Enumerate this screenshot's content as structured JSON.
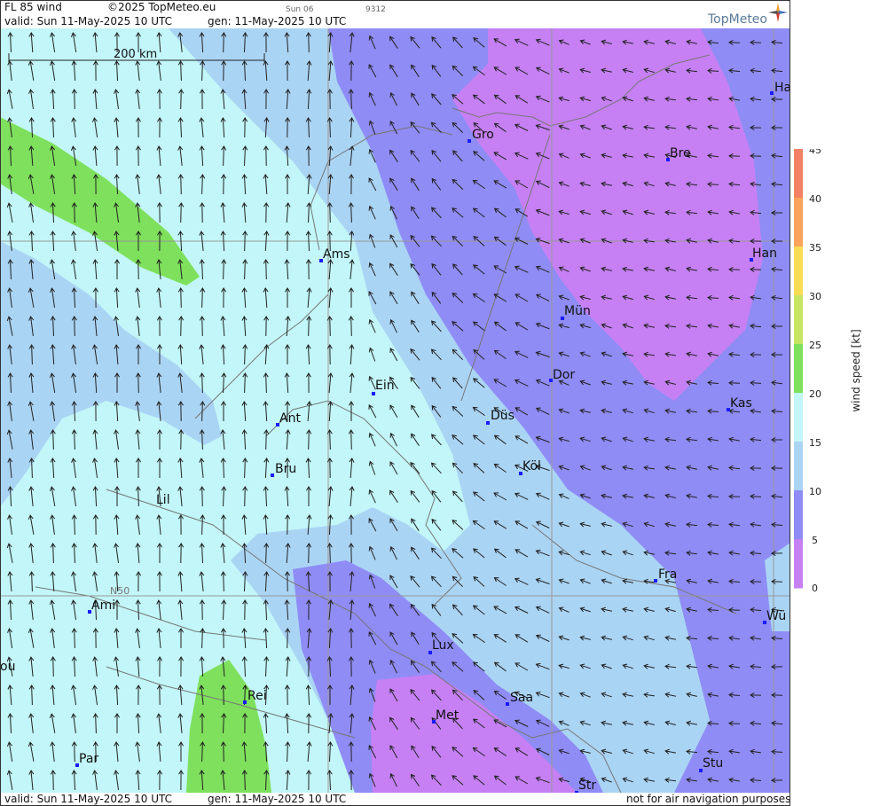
{
  "header": {
    "title": "FL 85 wind",
    "copyright": "©2025 TopMeteo.eu",
    "small_day": "Sun 06",
    "small_code": "9312",
    "valid": "valid:  Sun  11-May-2025  10 UTC",
    "generated": "gen: 11-May-2025 10 UTC",
    "brand": "TopMeteo"
  },
  "footer": {
    "valid": "valid:  Sun  11-May-2025  10 UTC",
    "generated": "gen: 11-May-2025 10 UTC",
    "disclaimer": "not for air navigation purposes"
  },
  "map": {
    "scale_label": "200 km",
    "grid_label": "N50",
    "cities": [
      "Ha",
      "Gro",
      "Bre",
      "Ams",
      "Han",
      "Mün",
      "Ein",
      "Dor",
      "Kas",
      "Ant",
      "Düs",
      "Bru",
      "Köl",
      "Lil",
      "Fra",
      "Ami",
      "Wü",
      "Lux",
      "Rei",
      "Saa",
      "Met",
      "Par",
      "Stu",
      "Str",
      "ou"
    ]
  },
  "legend": {
    "label": "wind  speed  [kt]",
    "ticks": [
      "45",
      "40",
      "35",
      "30",
      "25",
      "20",
      "15",
      "10",
      "5",
      "0"
    ],
    "colors": [
      "#f28164",
      "#f9a35c",
      "#fbdc55",
      "#c7e562",
      "#7ee05c",
      "#c2f6f8",
      "#aad4f4",
      "#8f8cf5",
      "#c680f4"
    ]
  }
}
